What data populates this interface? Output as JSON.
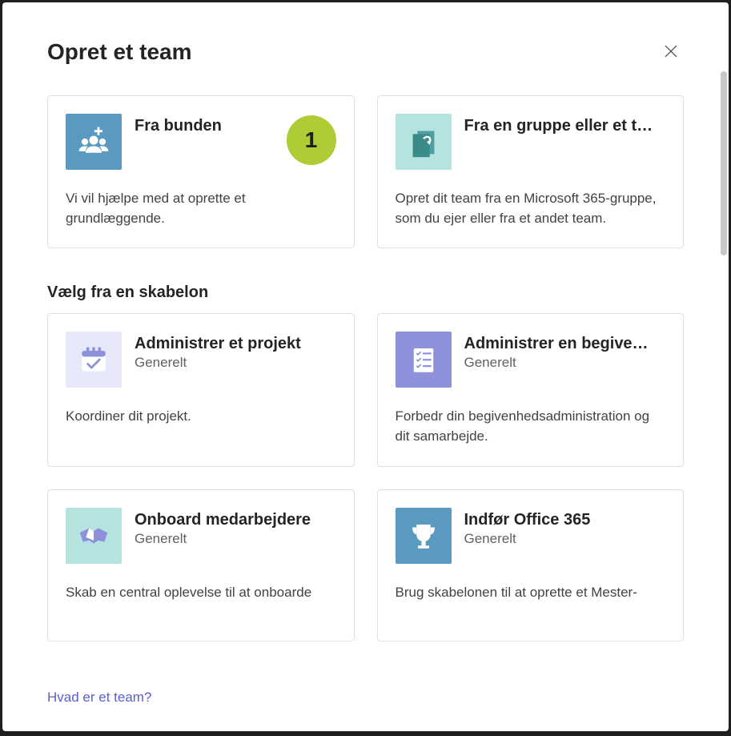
{
  "dialog": {
    "title": "Opret et team",
    "footer_link": "Hvad er et team?"
  },
  "top_cards": [
    {
      "title": "Fra bunden",
      "description": "Vi vil hjælpe med at oprette et grundlæggende.",
      "badge": "1"
    },
    {
      "title": "Fra en gruppe eller et t…",
      "description": "Opret dit team fra en Microsoft 365-gruppe, som du ejer eller fra et andet team."
    }
  ],
  "template_section": {
    "heading": "Vælg fra en skabelon"
  },
  "template_cards": [
    {
      "title": "Administrer et projekt",
      "subtitle": "Generelt",
      "description": "Koordiner dit projekt."
    },
    {
      "title": "Administrer en begive…",
      "subtitle": "Generelt",
      "description": "Forbedr din begivenhedsadministration og dit samarbejde."
    },
    {
      "title": "Onboard medarbejdere",
      "subtitle": "Generelt",
      "description": "Skab en central oplevelse til at onboarde"
    },
    {
      "title": "Indfør Office 365",
      "subtitle": "Generelt",
      "description": "Brug skabelonen til at oprette et Mester-"
    }
  ]
}
